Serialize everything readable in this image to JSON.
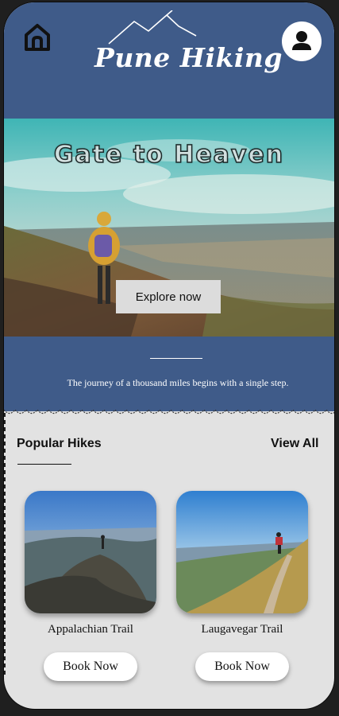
{
  "header": {
    "home_icon": "home-icon",
    "title": "Pune Hiking",
    "profile_icon": "user-icon",
    "brand_color": "#3f5b89"
  },
  "hero": {
    "title": "Gate to Heaven",
    "cta_label": "Explore now"
  },
  "quote": {
    "text": "The journey of a thousand miles begins with a single step."
  },
  "popular": {
    "title": "Popular Hikes",
    "view_all_label": "View All",
    "hikes": [
      {
        "name": "Appalachian Trail",
        "book_label": "Book Now"
      },
      {
        "name": "Laugavegar Trail",
        "book_label": "Book Now"
      }
    ]
  }
}
